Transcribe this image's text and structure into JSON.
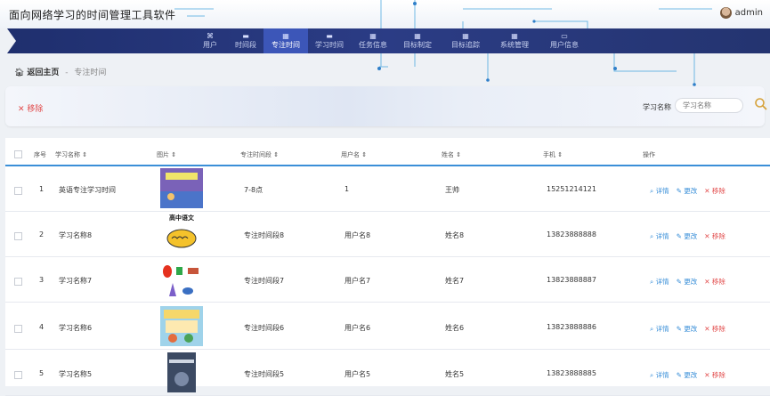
{
  "header": {
    "title": "面向网络学习的时间管理工具软件",
    "user": "admin"
  },
  "nav": [
    {
      "label": "用户",
      "icon": "⌘"
    },
    {
      "label": "时间段",
      "icon": "▬"
    },
    {
      "label": "专注时间",
      "icon": "▦",
      "active": true
    },
    {
      "label": "学习时间",
      "icon": "▬"
    },
    {
      "label": "任务信息",
      "icon": "▦"
    },
    {
      "label": "目标制定",
      "icon": "▦"
    },
    {
      "label": "目标追踪",
      "icon": "▦"
    },
    {
      "label": "系统管理",
      "icon": "▦"
    },
    {
      "label": "用户信息",
      "icon": "▭"
    }
  ],
  "breadcrumb": {
    "home": "返回主页",
    "current": "专注时间"
  },
  "toolbar": {
    "remove_label": "✕ 移除",
    "search_label": "学习名称",
    "search_placeholder": "学习名称"
  },
  "table": {
    "headers": [
      "序号",
      "学习名称",
      "图片",
      "专注时间段",
      "用户名",
      "姓名",
      "手机",
      "操作"
    ],
    "ops": {
      "detail": "⌕ 详情",
      "edit": "✎ 更改",
      "remove": "✕ 移除"
    },
    "rows": [
      {
        "no": "1",
        "name": "英语专注学习时间",
        "period": "7-8点",
        "username": "1",
        "realname": "王帅",
        "phone": "15251214121"
      },
      {
        "no": "2",
        "name": "学习名称8",
        "period": "专注时间段8",
        "username": "用户名8",
        "realname": "姓名8",
        "phone": "13823888888",
        "thumb_text": "高中语文"
      },
      {
        "no": "3",
        "name": "学习名称7",
        "period": "专注时间段7",
        "username": "用户名7",
        "realname": "姓名7",
        "phone": "13823888887"
      },
      {
        "no": "4",
        "name": "学习名称6",
        "period": "专注时间段6",
        "username": "用户名6",
        "realname": "姓名6",
        "phone": "13823888886"
      },
      {
        "no": "5",
        "name": "学习名称5",
        "period": "专注时间段5",
        "username": "用户名5",
        "realname": "姓名5",
        "phone": "13823888885"
      }
    ]
  },
  "colors": {
    "nav_bg": "#243470",
    "nav_active": "#3c56b8",
    "accent": "#3a8fd8",
    "danger": "#e24b4b"
  }
}
